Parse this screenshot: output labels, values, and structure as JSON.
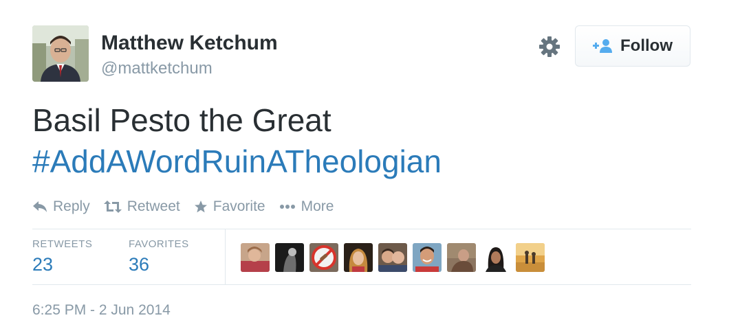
{
  "user": {
    "name": "Matthew Ketchum",
    "handle": "@mattketchum"
  },
  "follow_button": {
    "label": "Follow"
  },
  "tweet": {
    "text": "Basil Pesto the Great",
    "hashtag": "#AddAWordRuinATheologian"
  },
  "actions": [
    {
      "label": "Reply",
      "icon": "reply-icon"
    },
    {
      "label": "Retweet",
      "icon": "retweet-icon"
    },
    {
      "label": "Favorite",
      "icon": "star-icon"
    },
    {
      "label": "More",
      "icon": "more-dots-icon"
    }
  ],
  "stats": {
    "retweets_label": "RETWEETS",
    "retweets_count": "23",
    "favorites_label": "FAVORITES",
    "favorites_count": "36"
  },
  "timestamp": "6:25 PM - 2 Jun 2014",
  "colors": {
    "link": "#2b7bb9",
    "muted": "#8899a6",
    "text": "#292f33",
    "border": "#e1e8ed"
  }
}
